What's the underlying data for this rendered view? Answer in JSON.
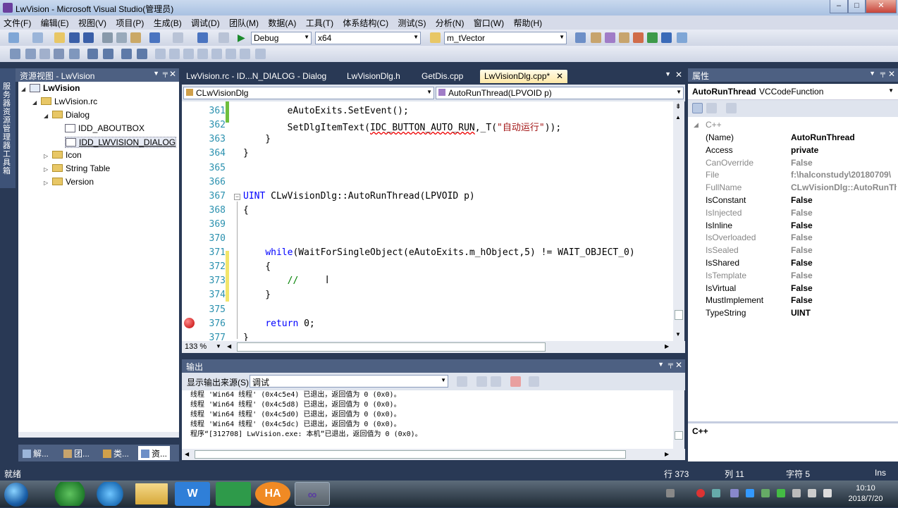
{
  "window": {
    "title": "LwVision - Microsoft Visual Studio(管理员)",
    "min": "–",
    "max": "□",
    "close": "✕"
  },
  "menu": [
    "文件(F)",
    "编辑(E)",
    "视图(V)",
    "项目(P)",
    "生成(B)",
    "调试(D)",
    "团队(M)",
    "数据(A)",
    "工具(T)",
    "体系结构(C)",
    "测试(S)",
    "分析(N)",
    "窗口(W)",
    "帮助(H)"
  ],
  "toolbar": {
    "config": "Debug",
    "platform": "x64",
    "find": "m_tVector"
  },
  "resource_view": {
    "title": "资源视图 - LwVision",
    "side_tab": "服务器资源管理器 工具箱",
    "tree": [
      {
        "label": "LwVision",
        "level": 0,
        "kind": "project",
        "expanded": true
      },
      {
        "label": "LwVision.rc",
        "level": 1,
        "kind": "folder",
        "expanded": true
      },
      {
        "label": "Dialog",
        "level": 2,
        "kind": "folder",
        "expanded": true
      },
      {
        "label": "IDD_ABOUTBOX",
        "level": 3,
        "kind": "dialog"
      },
      {
        "label": "IDD_LWVISION_DIALOG",
        "level": 3,
        "kind": "dialog",
        "selected": true
      },
      {
        "label": "Icon",
        "level": 2,
        "kind": "folder",
        "expanded": false
      },
      {
        "label": "String Table",
        "level": 2,
        "kind": "folder",
        "expanded": false
      },
      {
        "label": "Version",
        "level": 2,
        "kind": "folder",
        "expanded": false
      }
    ],
    "bottom_tabs": [
      "解...",
      "团...",
      "类...",
      "资..."
    ]
  },
  "editor": {
    "tabs": [
      {
        "label": "LwVision.rc - ID...N_DIALOG - Dialog",
        "active": false
      },
      {
        "label": "LwVisionDlg.h",
        "active": false
      },
      {
        "label": "GetDis.cpp",
        "active": false
      },
      {
        "label": "LwVisionDlg.cpp*",
        "active": true
      }
    ],
    "class_combo": "CLwVisionDlg",
    "member_combo": "AutoRunThread(LPVOID p)",
    "zoom": "133 %",
    "lines": [
      {
        "n": "361",
        "text": "        eAutoExits.SetEvent();"
      },
      {
        "n": "362",
        "text": "        SetDlgItemText(IDC_BUTTON_AUTO_RUN,_T(\"自动运行\"));"
      },
      {
        "n": "363",
        "text": "    }"
      },
      {
        "n": "364",
        "text": "}"
      },
      {
        "n": "365",
        "text": ""
      },
      {
        "n": "366",
        "text": ""
      },
      {
        "n": "367",
        "text": "UINT CLwVisionDlg::AutoRunThread(LPVOID p)"
      },
      {
        "n": "368",
        "text": "{"
      },
      {
        "n": "369",
        "text": ""
      },
      {
        "n": "370",
        "text": ""
      },
      {
        "n": "371",
        "text": "    while(WaitForSingleObject(eAutoExits.m_hObject,5) != WAIT_OBJECT_0)"
      },
      {
        "n": "372",
        "text": "    {"
      },
      {
        "n": "373",
        "text": "        //"
      },
      {
        "n": "374",
        "text": "    }"
      },
      {
        "n": "375",
        "text": ""
      },
      {
        "n": "376",
        "text": "    return 0;"
      },
      {
        "n": "377",
        "text": "}"
      }
    ]
  },
  "output": {
    "title": "输出",
    "source_label": "显示输出来源(S):",
    "source_value": "调试",
    "lines": [
      "线程 'Win64 线程' (0x4c5e4) 已退出，返回值为 0 (0x0)。",
      "线程 'Win64 线程' (0x4c5d8) 已退出，返回值为 0 (0x0)。",
      "线程 'Win64 线程' (0x4c5d0) 已退出，返回值为 0 (0x0)。",
      "线程 'Win64 线程' (0x4c5dc) 已退出，返回值为 0 (0x0)。",
      "程序“[312708] LwVision.exe: 本机”已退出，返回值为 0 (0x0)。"
    ]
  },
  "properties": {
    "title": "属性",
    "object_name": "AutoRunThread",
    "object_type": "VCCodeFunction",
    "category": "C++",
    "rows": [
      {
        "name": "(Name)",
        "value": "AutoRunThread",
        "gray": false
      },
      {
        "name": "Access",
        "value": "private",
        "gray": false
      },
      {
        "name": "CanOverride",
        "value": "False",
        "gray": true
      },
      {
        "name": "File",
        "value": "f:\\halconstudy\\20180709\\",
        "gray": true
      },
      {
        "name": "FullName",
        "value": "CLwVisionDlg::AutoRunThread",
        "gray": true
      },
      {
        "name": "IsConstant",
        "value": "False",
        "gray": false
      },
      {
        "name": "IsInjected",
        "value": "False",
        "gray": true
      },
      {
        "name": "IsInline",
        "value": "False",
        "gray": false
      },
      {
        "name": "IsOverloaded",
        "value": "False",
        "gray": true
      },
      {
        "name": "IsSealed",
        "value": "False",
        "gray": true
      },
      {
        "name": "IsShared",
        "value": "False",
        "gray": false
      },
      {
        "name": "IsTemplate",
        "value": "False",
        "gray": true
      },
      {
        "name": "IsVirtual",
        "value": "False",
        "gray": false
      },
      {
        "name": "MustImplement",
        "value": "False",
        "gray": false
      },
      {
        "name": "TypeString",
        "value": "UINT",
        "gray": false
      }
    ],
    "description": "C++"
  },
  "status": {
    "ready": "就绪",
    "line": "行 373",
    "col": "列 11",
    "char": "字符 5",
    "mode": "Ins"
  },
  "taskbar": {
    "time": "10:10",
    "date": "2018/7/20",
    "apps": [
      "W",
      "HA"
    ]
  }
}
